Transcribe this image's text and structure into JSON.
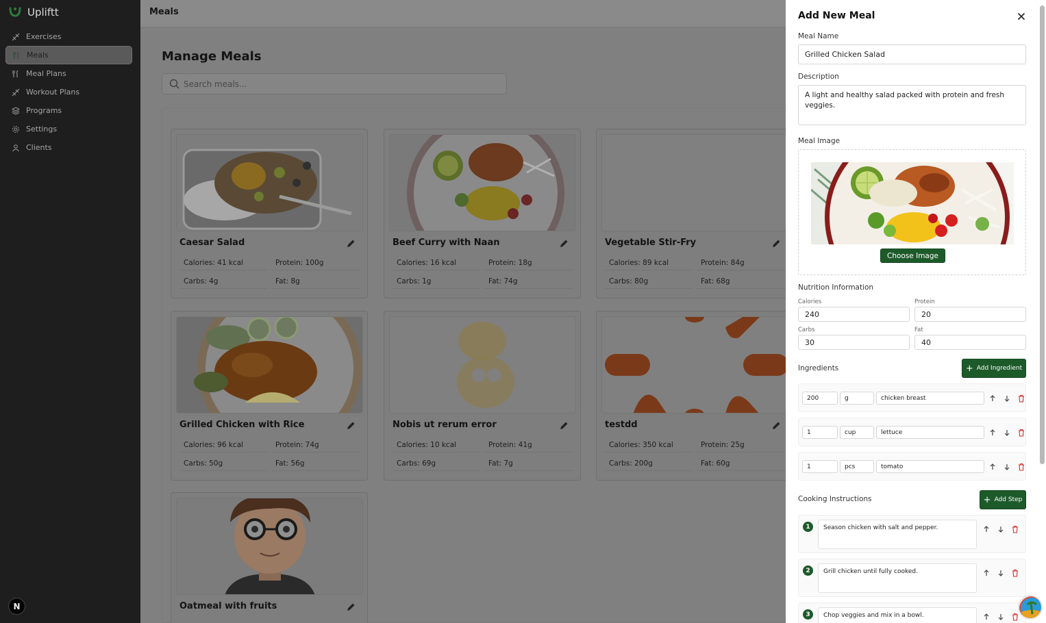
{
  "app": {
    "name": "Upliftt"
  },
  "sidebar": {
    "items": [
      {
        "label": "Exercises",
        "icon": "exercises-icon"
      },
      {
        "label": "Meals",
        "icon": "meals-icon",
        "active": true
      },
      {
        "label": "Meal Plans",
        "icon": "meal-plans-icon"
      },
      {
        "label": "Workout Plans",
        "icon": "workout-plans-icon"
      },
      {
        "label": "Programs",
        "icon": "programs-icon"
      },
      {
        "label": "Settings",
        "icon": "settings-icon"
      },
      {
        "label": "Clients",
        "icon": "clients-icon"
      }
    ],
    "badge": "N"
  },
  "header": {
    "title": "Meals"
  },
  "main": {
    "title": "Manage Meals",
    "search_placeholder": "Search meals...",
    "meals": [
      {
        "name": "Caesar Salad",
        "calories": "Calories: 41 kcal",
        "protein": "Protein: 100g",
        "carbs": "Carbs: 4g",
        "fat": "Fat: 8g"
      },
      {
        "name": "Beef Curry with Naan",
        "calories": "Calories: 16 kcal",
        "protein": "Protein: 18g",
        "carbs": "Carbs: 1g",
        "fat": "Fat: 74g"
      },
      {
        "name": "Vegetable Stir-Fry",
        "calories": "Calories: 89 kcal",
        "protein": "Protein: 84g",
        "carbs": "Carbs: 80g",
        "fat": "Fat: 68g"
      },
      {
        "name": "Grilled Chicken with Rice",
        "calories": "Calories: 96 kcal",
        "protein": "Protein: 74g",
        "carbs": "Carbs: 50g",
        "fat": "Fat: 56g"
      },
      {
        "name": "Nobis ut rerum error",
        "calories": "Calories: 10 kcal",
        "protein": "Protein: 41g",
        "carbs": "Carbs: 69g",
        "fat": "Fat: 7g"
      },
      {
        "name": "testdd",
        "calories": "Calories: 350 kcal",
        "protein": "Protein: 25g",
        "carbs": "Carbs: 200g",
        "fat": "Fat: 60g"
      },
      {
        "name": "Oatmeal with fruits"
      }
    ]
  },
  "drawer": {
    "title": "Add New Meal",
    "meal_name_label": "Meal Name",
    "meal_name_value": "Grilled Chicken Salad",
    "description_label": "Description",
    "description_value": "A light and healthy salad packed with protein and fresh veggies.",
    "image_label": "Meal Image",
    "choose_image": "Choose Image",
    "nutrition_label": "Nutrition Information",
    "nutrition": {
      "calories_label": "Calories",
      "calories": "240",
      "protein_label": "Protein",
      "protein": "20",
      "carbs_label": "Carbs",
      "carbs": "30",
      "fat_label": "Fat",
      "fat": "40"
    },
    "ingredients_label": "Ingredients",
    "add_ingredient": "Add Ingredient",
    "ingredients": [
      {
        "qty": "200",
        "unit": "g",
        "name": "chicken breast"
      },
      {
        "qty": "1",
        "unit": "cup",
        "name": "lettuce"
      },
      {
        "qty": "1",
        "unit": "pcs",
        "name": "tomato"
      }
    ],
    "instructions_label": "Cooking Instructions",
    "add_step": "Add Step",
    "steps": [
      {
        "num": "1",
        "text": "Season chicken with salt and pepper."
      },
      {
        "num": "2",
        "text": "Grill chicken until fully cooked."
      },
      {
        "num": "3",
        "text": "Chop veggies and mix in a bowl."
      }
    ]
  },
  "colors": {
    "accent": "#1d5a2a",
    "sidebar": "#1e1e1e",
    "overlay": "#808080"
  }
}
